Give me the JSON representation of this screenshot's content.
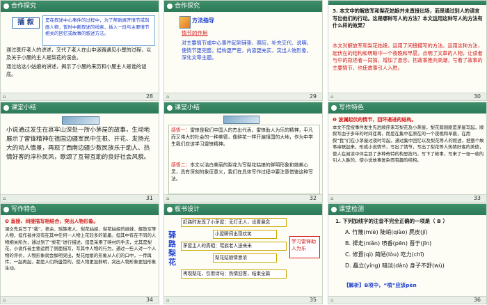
{
  "colors": {
    "band": "#2c7a58",
    "accent_red": "#d21919",
    "accent_blue": "#1f3fcf"
  },
  "slides": [
    {
      "num": "28",
      "title": "合作探究",
      "tag": "插 叙",
      "box_text": "是在叙述中心事件的过程中，为了帮助展开情节或刻画人物，暂时中断叙述的线索，插入一段与主要情节相关的回忆或故事的叙述方法。",
      "body": "通过医疗老人的讲述，交代了老人在山中迷路遇见小屋的过程，以及关于小屋的主人是梨花的误会。",
      "body2": "通过给这小姑娘的讲述，揭示了小屋的来历和小屋主人是谁的谜底。"
    },
    {
      "num": "29",
      "title": "合作探究",
      "heading": "方法指导",
      "subheading": "情节的作用",
      "body": "对主要情节或中心事件起到铺垫、照应、补充交代、说明，使情节更完整，结构更严密，内容更充实，突出人物形象，深化文章主题。"
    },
    {
      "num": "30",
      "question": "3. 本文中的解放军和梨花姑娘并未直接出场，而是通过别人的语言写出他们的行动。这是哪种写人的方法？本文运用这种写人的方法有什么样的效果？",
      "answer": "本文对解放军和梨花姑娘，运用了间接描写的方法。运用这种方法，起伏在的结构和明晰中一个夜晚和早晨，点明了文章的人物，让读者与中的叙述者一同猜，增加了悬念，把故事推向高潮，写着了故事的主要情节，也使故事引人入胜。"
    },
    {
      "num": "31",
      "title": "课堂小结",
      "body": "小说通过发生在哀牢山深处一所小茅屋的故事，生动地展示了雷锋精神在祖国边疆军民中生根、开花、发扬光大的动人情景，再现了西南边疆少数民族乐于助人、热情好客的淳朴民风，歌颂了互帮互助的良好社会风貌。"
    },
    {
      "num": "32",
      "title": "课堂小结",
      "p1_label": "感悟一：",
      "p1": "雷锋是我们中国人的杰出代表，雷锋助人为乐的精神，平凡而又伟大的社会的一种美德，像鲜花一样开遍祖国的大地，作为中学生我们应该学习雷锋精神。",
      "p2_label": "感悟二：",
      "p2": "本文以洁白美丽的梨花为写梨花姑娘的鲜明形象和她美心灵，具有深刻的象征意义，我们在具体写作过程中要注意借鉴这种写法。"
    },
    {
      "num": "33",
      "title": "写作特色",
      "point_label": "❶ 波澜起伏的情节，回环递进的结构。",
      "body": "本文不是按事件发生先后顺序来写梨花及小茅屋，梨花荫刚刚是茅屋写起，顺叙写由于多年的时间荏苒，而是在集中在原在的一个夜晚和早晨，在用叙“我”们在小茅屋过夜时写起，通过集中回忆以及梨花等人的叙述，把整个故事串联起来，形成小说情节，写出了情节，写出了梨花等人热情好客的美德，使人在阅读中体会到了多种奇特的构思技巧，写下了故事，写来了一张一收的引人入胜的，使小说故事复杂而有趣的结构。"
    },
    {
      "num": "34",
      "title": "写作特色",
      "point_label": "❷ 直接、间接描写相结合，突出人物形象。",
      "body": "课文先后写了“我”、老余、瑶族老人、梨花姑娘、梨花姑娘的妹妹、解放军等人物，但作者并没有在其中任何一人物上花较多的笔墨。但其中有在不同的人物相关所为，通过到了“梨花”进行描述，但是采用了映衬的手法，尤其是梨花，小说作者主要运用了侧面描写，写其中人物的行为，通过一些人对一个人物的评价，人物形象就会鲜明突出，梨花姑娘的形象从人们的口中，一传再传，一起再起，都是人们所盛赞的，使人物更加鲜明，突出人物形象更加形象生动。"
    },
    {
      "num": "35",
      "title": "板书设计",
      "side": "驿路梨花",
      "lines": [
        "赶路时发现了小茅屋：无灯无人，设置悬念",
        "小屋瞬间出现欢笑",
        "茅屋主人的真相：瑶族老人送来米",
        "梨花姑娘情意浓",
        "再现梨花，引用诗句：热情迎客，结束全篇"
      ],
      "right": "学习雷锋助人为乐"
    },
    {
      "num": "36",
      "title": "课堂检测",
      "question": "1. 下列加线字的注音不完全正确的一项是（ B ）",
      "options": [
        "A. 竹篾(miè)  陡峭(qiào)  麂皮(jǐ)",
        "B. 撵走(niǎn)  喷香(pēn)  晋于(jīn)",
        "C. 修葺(qì)  简陋(lòu)  吃力(chī)",
        "D. 矗立(yíng)  暗淡(dàn)  身子不舒(wù)"
      ],
      "explain": "【解析】B项中，“喷”应该pèn"
    }
  ]
}
